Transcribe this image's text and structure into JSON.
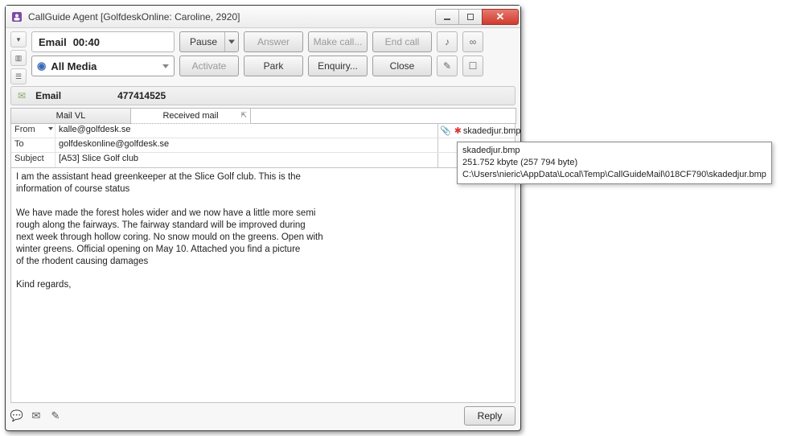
{
  "window": {
    "title": "CallGuide Agent [GolfdeskOnline: Caroline, 2920]"
  },
  "status": {
    "channel_label": "Email",
    "timer": "00:40"
  },
  "buttons": {
    "pause": "Pause",
    "answer": "Answer",
    "make_call": "Make call...",
    "end_call": "End call",
    "activate": "Activate",
    "park": "Park",
    "enquiry": "Enquiry...",
    "close": "Close",
    "reply": "Reply"
  },
  "media": {
    "label": "All Media"
  },
  "info": {
    "type": "Email",
    "id": "477414525"
  },
  "tabs": {
    "mail_vl": "Mail VL",
    "received_mail": "Received mail"
  },
  "headers": {
    "from_label": "From",
    "from_value": "kalle@golfdesk.se",
    "to_label": "To",
    "to_value": "golfdeskonline@golfdesk.se",
    "subject_label": "Subject",
    "subject_value": "[A53] Slice Golf club"
  },
  "attachment": {
    "name": "skadedjur.bmp"
  },
  "body": "I am the assistant head greenkeeper at the Slice Golf club. This is the\ninformation of course status\n\nWe have made the forest holes wider and we now have a little more semi\nrough along the fairways. The fairway standard will be improved during\nnext week through hollow coring. No snow mould on the greens. Open with\nwinter greens. Official opening on May 10. Attached you find a picture\nof the rhodent causing damages\n\nKind regards,",
  "tooltip": {
    "name": "skadedjur.bmp",
    "size": "251.752 kbyte (257 794 byte)",
    "path": "C:\\Users\\nieric\\AppData\\Local\\Temp\\CallGuideMail\\018CF790\\skadedjur.bmp"
  }
}
